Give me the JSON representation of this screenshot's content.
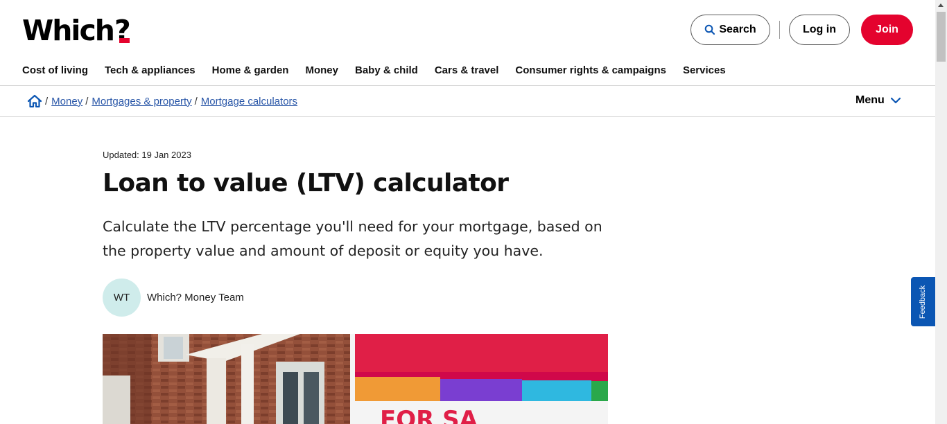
{
  "header": {
    "logo_text": "Which",
    "logo_mark": "?",
    "search_label": "Search",
    "login_label": "Log in",
    "join_label": "Join",
    "brand_red": "#e4032e"
  },
  "nav": {
    "items": [
      {
        "label": "Cost of living"
      },
      {
        "label": "Tech & appliances"
      },
      {
        "label": "Home & garden"
      },
      {
        "label": "Money"
      },
      {
        "label": "Baby & child"
      },
      {
        "label": "Cars & travel"
      },
      {
        "label": "Consumer rights & campaigns"
      },
      {
        "label": "Services"
      }
    ]
  },
  "breadcrumb": {
    "home_icon": "home-icon",
    "items": [
      {
        "label": "Money"
      },
      {
        "label": "Mortgages & property"
      },
      {
        "label": "Mortgage calculators"
      }
    ],
    "menu_label": "Menu"
  },
  "article": {
    "updated": "Updated: 19 Jan 2023",
    "title": "Loan to value (LTV) calculator",
    "standfirst": "Calculate the LTV percentage you'll need for your mortgage, based on the property value and amount of deposit or equity you have.",
    "author_initials": "WT",
    "author_name": "Which? Money Team"
  },
  "feedback": {
    "label": "Feedback",
    "color": "#0b56b3"
  }
}
